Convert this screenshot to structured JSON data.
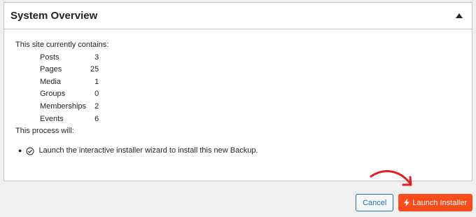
{
  "panel": {
    "title": "System Overview",
    "toggle_icon": "triangle-up-icon",
    "intro": "This site currently contains:",
    "counts": [
      {
        "label": "Posts",
        "value": "3"
      },
      {
        "label": "Pages",
        "value": "25"
      },
      {
        "label": "Media",
        "value": "1"
      },
      {
        "label": "Groups",
        "value": "0"
      },
      {
        "label": "Memberships",
        "value": "2"
      },
      {
        "label": "Events",
        "value": "6"
      }
    ],
    "process_heading": "This process will:",
    "tasks": [
      {
        "icon": "check-circle-icon",
        "text": "Launch the interactive installer wizard to install this new Backup."
      }
    ]
  },
  "actions": {
    "cancel_label": "Cancel",
    "launch_label": "Launch Installer",
    "launch_icon": "bolt-icon"
  },
  "annotation": {
    "icon": "curved-arrow-icon",
    "color": "#e2202a"
  },
  "colors": {
    "accent": "#fa4d1e",
    "link": "#2271b1",
    "border": "#c3c4c7"
  }
}
